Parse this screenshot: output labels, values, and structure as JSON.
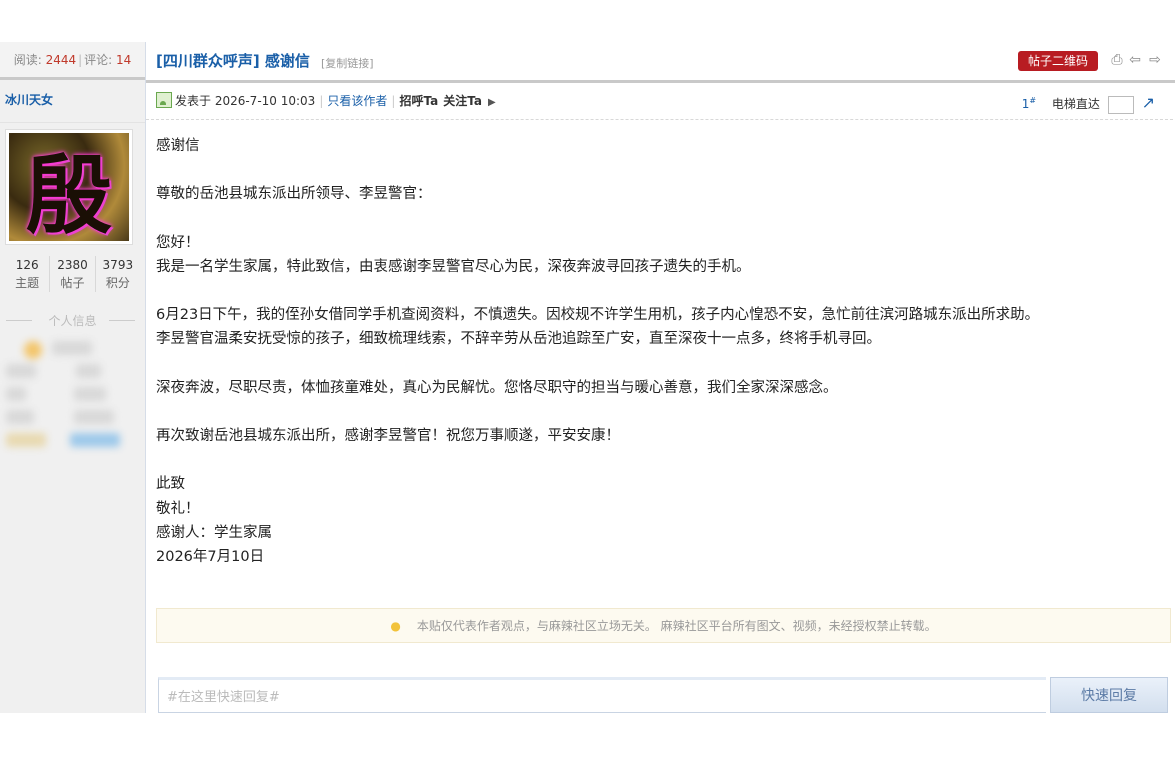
{
  "thread": {
    "views_label": "阅读:",
    "views": "2444",
    "comments_label": "评论:",
    "comments": "14",
    "title": "[四川群众呼声] 感谢信",
    "copy_link": "[复制链接]",
    "qr_button": "帖子二维码"
  },
  "author": {
    "name": "冰川天女",
    "avatar_glyph": "殷",
    "stats": [
      {
        "value": "126",
        "label": "主题"
      },
      {
        "value": "2380",
        "label": "帖子"
      },
      {
        "value": "3793",
        "label": "积分"
      }
    ],
    "personal_info_label": "个人信息"
  },
  "post_meta": {
    "posted_at": "发表于 2026-7-10 10:03",
    "only_author": "只看该作者",
    "greet": "招呼Ta",
    "follow": "关注Ta",
    "floor": "1",
    "floor_mark": "#",
    "jump_label": "电梯直达"
  },
  "content": {
    "paragraphs": [
      "感谢信",
      "",
      "尊敬的岳池县城东派出所领导、李昱警官：",
      "",
      "您好！",
      "我是一名学生家属，特此致信，由衷感谢李昱警官尽心为民，深夜奔波寻回孩子遗失的手机。",
      "",
      "6月23日下午，我的侄孙女借同学手机查阅资料，不慎遗失。因校规不许学生用机，孩子内心惶恐不安，急忙前往滨河路城东派出所求助。",
      "李昱警官温柔安抚受惊的孩子，细致梳理线索，不辞辛劳从岳池追踪至广安，直至深夜十一点多，终将手机寻回。",
      "",
      "深夜奔波，尽职尽责，体恤孩童难处，真心为民解忧。您恪尽职守的担当与暖心善意，我们全家深深感念。",
      "",
      "再次致谢岳池县城东派出所，感谢李昱警官！祝您万事顺遂，平安安康！",
      "",
      "此致",
      "敬礼！",
      "感谢人：学生家属",
      "2026年7月10日"
    ]
  },
  "notice": "本贴仅代表作者观点，与麻辣社区立场无关。 麻辣社区平台所有图文、视频，未经授权禁止转载。",
  "reply": {
    "placeholder": "#在这里快速回复#",
    "button": "快速回复"
  },
  "icons": [
    "print-icon",
    "prev-thread-icon",
    "next-thread-icon",
    "post-icon",
    "bulb-icon",
    "go-icon"
  ]
}
